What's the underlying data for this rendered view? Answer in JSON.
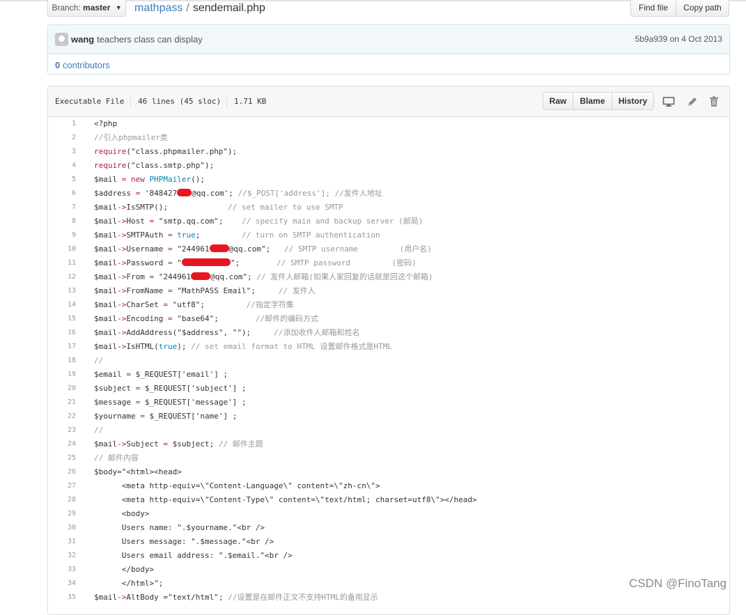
{
  "breadcrumb": {
    "branch_label": "Branch:",
    "branch_value": "master",
    "repo": "mathpass",
    "separator": "/",
    "file": "sendemail.php"
  },
  "actions": {
    "find_file": "Find file",
    "copy_path": "Copy path"
  },
  "commit": {
    "author": "wang",
    "message": "teachers class can display",
    "sha_date": "5b9a939 on 4 Oct 2013"
  },
  "contributors": {
    "count": "0",
    "label": "contributors"
  },
  "file_info": {
    "type": "Executable File",
    "lines": "46 lines (45 sloc)",
    "size": "1.71 KB"
  },
  "file_buttons": {
    "raw": "Raw",
    "blame": "Blame",
    "history": "History"
  },
  "icons": [
    "desktop-icon",
    "pencil-icon",
    "trash-icon"
  ],
  "code_lines": [
    {
      "n": "1",
      "t": "<?php"
    },
    {
      "n": "2",
      "t": "//引入phpmailer类"
    },
    {
      "n": "3",
      "t": "require(\"class.phpmailer.php\");"
    },
    {
      "n": "4",
      "t": "require(\"class.smtp.php\");"
    },
    {
      "n": "5",
      "t": "$mail = new PHPMailer();"
    },
    {
      "n": "6",
      "t": "$address = '848427███@qq.com'; //$_POST['address']; //发件人地址"
    },
    {
      "n": "7",
      "t": "$mail->IsSMTP();             // set mailer to use SMTP"
    },
    {
      "n": "8",
      "t": "$mail->Host = \"smtp.qq.com\";    // specify main and backup server (邮局)"
    },
    {
      "n": "9",
      "t": "$mail->SMTPAuth = true;         // turn on SMTP authentication"
    },
    {
      "n": "10",
      "t": "$mail->Username = \"244961████@qq.com\";   // SMTP username         (用户名)"
    },
    {
      "n": "11",
      "t": "$mail->Password = \"██████████\";        // SMTP password         (密码)"
    },
    {
      "n": "12",
      "t": "$mail->From = \"244961████@qq.com\"; // 发件人邮箱(如果人家回复的话就是回这个邮箱)"
    },
    {
      "n": "13",
      "t": "$mail->FromName = \"MathPASS Email\";     // 发件人"
    },
    {
      "n": "14",
      "t": "$mail->CharSet = \"utf8\";         //指定字符集"
    },
    {
      "n": "15",
      "t": "$mail->Encoding = \"base64\";        //邮件的编码方式"
    },
    {
      "n": "16",
      "t": "$mail->AddAddress(\"$address\", \"\");     //添加收件人邮箱和姓名"
    },
    {
      "n": "17",
      "t": "$mail->IsHTML(true); // set email format to HTML 设置邮件格式是HTML"
    },
    {
      "n": "18",
      "t": "//"
    },
    {
      "n": "19",
      "t": "$email = $_REQUEST['email'] ;"
    },
    {
      "n": "20",
      "t": "$subject = $_REQUEST['subject'] ;"
    },
    {
      "n": "21",
      "t": "$message = $_REQUEST['message'] ;"
    },
    {
      "n": "22",
      "t": "$yourname = $_REQUEST['name'] ;"
    },
    {
      "n": "23",
      "t": "//"
    },
    {
      "n": "24",
      "t": "$mail->Subject = $subject; // 邮件主题"
    },
    {
      "n": "25",
      "t": "// 邮件内容"
    },
    {
      "n": "26",
      "t": "$body=\"<html><head>"
    },
    {
      "n": "27",
      "t": "      <meta http-equiv=\\\"Content-Language\\\" content=\\\"zh-cn\\\">"
    },
    {
      "n": "28",
      "t": "      <meta http-equiv=\\\"Content-Type\\\" content=\\\"text/html; charset=utf8\\\"></head>"
    },
    {
      "n": "29",
      "t": "      <body>"
    },
    {
      "n": "30",
      "t": "      Users name: \".$yourname.\"<br />"
    },
    {
      "n": "31",
      "t": "      Users message: \".$message.\"<br />"
    },
    {
      "n": "32",
      "t": "      Users email address: \".$email.\"<br />"
    },
    {
      "n": "33",
      "t": "      </body>"
    },
    {
      "n": "34",
      "t": "      </html>\";"
    },
    {
      "n": "35",
      "t": "$mail->AltBody =\"text/html\"; //设置是在邮件正文不支持HTML的备用显示"
    }
  ],
  "watermark": "CSDN @FinoTang"
}
